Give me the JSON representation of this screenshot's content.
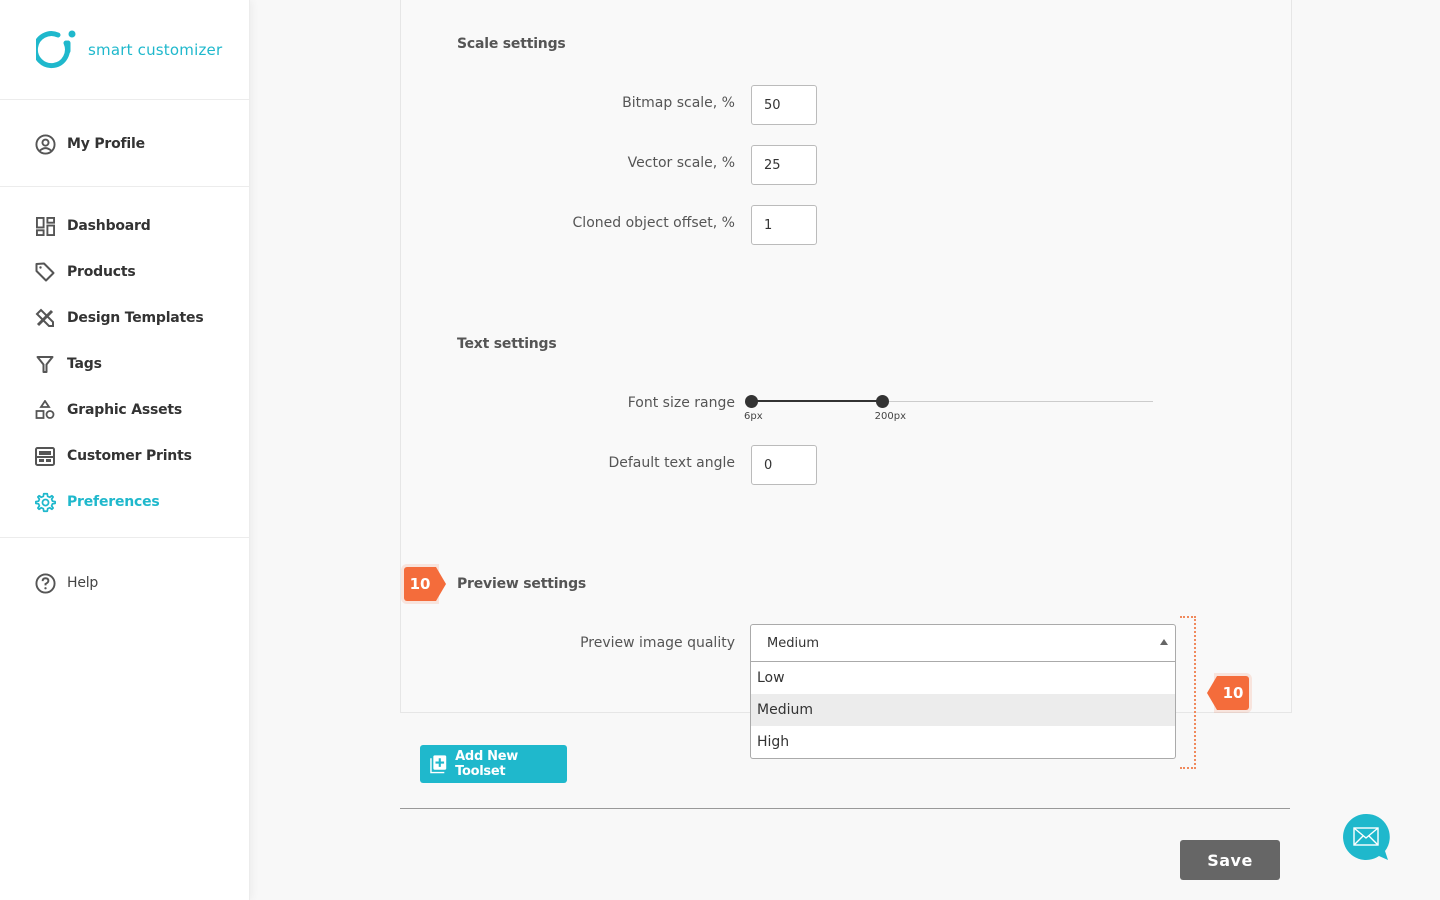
{
  "brand": {
    "name": "smart customizer",
    "color": "#1fb8cc"
  },
  "sidebar": {
    "profile": {
      "label": "My Profile",
      "icon": "user-circle-icon"
    },
    "items": [
      {
        "label": "Dashboard",
        "icon": "dashboard-icon",
        "active": false
      },
      {
        "label": "Products",
        "icon": "tag-icon",
        "active": false
      },
      {
        "label": "Design Templates",
        "icon": "design-tools-icon",
        "active": false
      },
      {
        "label": "Tags",
        "icon": "filter-icon",
        "active": false
      },
      {
        "label": "Graphic Assets",
        "icon": "shapes-icon",
        "active": false
      },
      {
        "label": "Customer Prints",
        "icon": "prints-icon",
        "active": false
      },
      {
        "label": "Preferences",
        "icon": "gear-icon",
        "active": true
      }
    ],
    "help": {
      "label": "Help",
      "icon": "question-circle-icon"
    }
  },
  "scale_settings": {
    "title": "Scale settings",
    "fields": [
      {
        "label": "Bitmap scale, %",
        "value": "50"
      },
      {
        "label": "Vector scale, %",
        "value": "25"
      },
      {
        "label": "Cloned object offset, %",
        "value": "1"
      }
    ]
  },
  "text_settings": {
    "title": "Text settings",
    "font_size_range": {
      "label": "Font size range",
      "min_label": "6px",
      "max_label": "200px",
      "low_value": 6,
      "high_value": 200,
      "low_fraction": 0.0,
      "high_fraction": 0.325
    },
    "default_angle": {
      "label": "Default text angle",
      "value": "0"
    }
  },
  "preview_settings": {
    "title": "Preview settings",
    "quality": {
      "label": "Preview image quality",
      "selected": "Medium",
      "options": [
        "Low",
        "Medium",
        "High"
      ],
      "highlighted": "Medium"
    }
  },
  "annotations": {
    "step_badge_left": "10",
    "step_badge_right": "10",
    "accent": "#f46c3b"
  },
  "actions": {
    "add_toolset": "Add New Toolset",
    "save": "Save"
  }
}
